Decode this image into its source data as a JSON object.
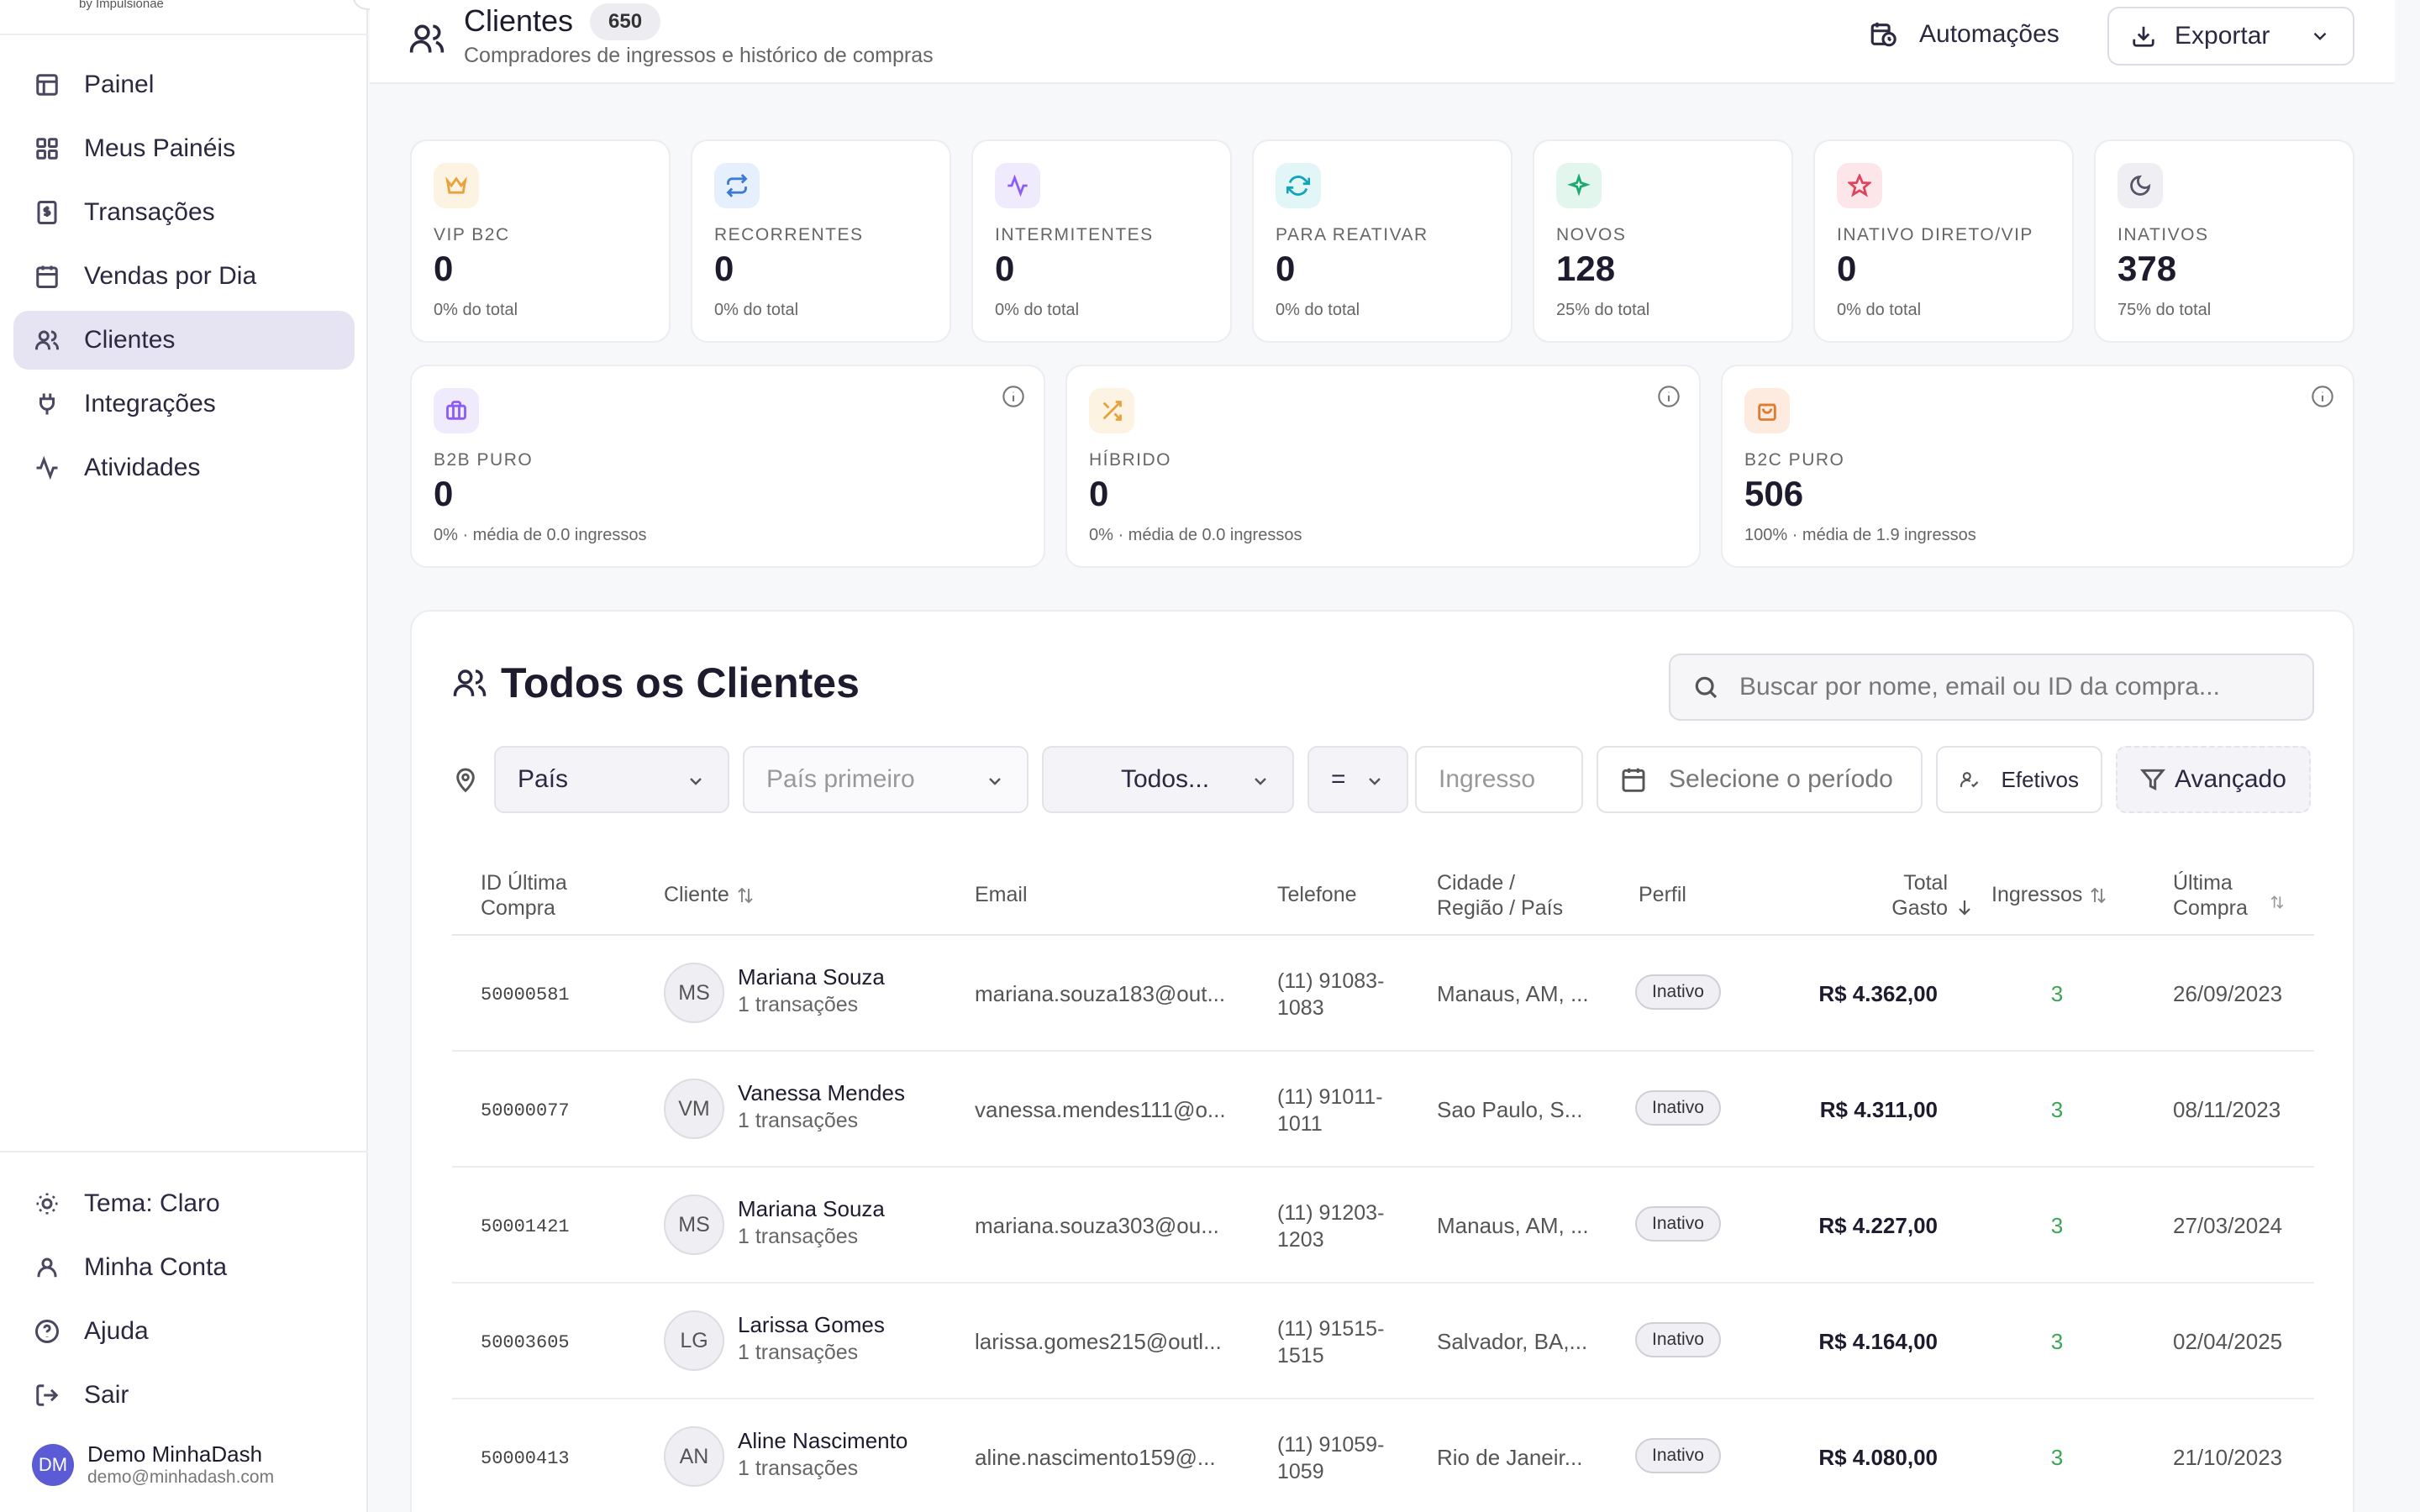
{
  "brand": {
    "tagline": "by Impulsionaê"
  },
  "sidebar": {
    "items": [
      {
        "label": "Painel",
        "icon": "layout-icon"
      },
      {
        "label": "Meus Painéis",
        "icon": "grid-icon"
      },
      {
        "label": "Transações",
        "icon": "receipt-icon"
      },
      {
        "label": "Vendas por Dia",
        "icon": "calendar-icon"
      },
      {
        "label": "Clientes",
        "icon": "users-icon",
        "active": true
      },
      {
        "label": "Integrações",
        "icon": "plug-icon"
      },
      {
        "label": "Atividades",
        "icon": "activity-icon"
      }
    ],
    "bottom": [
      {
        "label": "Tema: Claro",
        "icon": "sun-icon"
      },
      {
        "label": "Minha Conta",
        "icon": "user-icon"
      },
      {
        "label": "Ajuda",
        "icon": "help-icon"
      },
      {
        "label": "Sair",
        "icon": "logout-icon"
      }
    ],
    "user": {
      "initials": "DM",
      "name": "Demo MinhaDash",
      "email": "demo@minhadash.com"
    }
  },
  "header": {
    "title": "Clientes",
    "count": "650",
    "subtitle": "Compradores de ingressos e histórico de compras",
    "automations_label": "Automações",
    "export_label": "Exportar"
  },
  "stats": [
    {
      "label": "VIP B2C",
      "value": "0",
      "sub": "0% do total",
      "icon": "crown-icon",
      "color": "#e8a23a",
      "bg": "#fdf3e2"
    },
    {
      "label": "RECORRENTES",
      "value": "0",
      "sub": "0% do total",
      "icon": "repeat-icon",
      "color": "#3a7bd5",
      "bg": "#e6effc"
    },
    {
      "label": "INTERMITENTES",
      "value": "0",
      "sub": "0% do total",
      "icon": "pulse-icon",
      "color": "#8b5cf6",
      "bg": "#f0eafd"
    },
    {
      "label": "PARA REATIVAR",
      "value": "0",
      "sub": "0% do total",
      "icon": "refresh-icon",
      "color": "#12a4b8",
      "bg": "#e2f6f8"
    },
    {
      "label": "NOVOS",
      "value": "128",
      "sub": "25% do total",
      "icon": "sparkle-icon",
      "color": "#1fa971",
      "bg": "#e2f6ed"
    },
    {
      "label": "INATIVO DIRETO/VIP",
      "value": "0",
      "sub": "0% do total",
      "icon": "star-icon",
      "color": "#e0435c",
      "bg": "#fde6ea"
    },
    {
      "label": "INATIVOS",
      "value": "378",
      "sub": "75% do total",
      "icon": "moon-icon",
      "color": "#555566",
      "bg": "#efeff3"
    }
  ],
  "segments": [
    {
      "label": "B2B PURO",
      "value": "0",
      "sub": "0% · média de 0.0 ingressos",
      "icon": "briefcase-icon",
      "color": "#8b5cf6",
      "bg": "#f0eafd"
    },
    {
      "label": "HÍBRIDO",
      "value": "0",
      "sub": "0% · média de 0.0 ingressos",
      "icon": "shuffle-icon",
      "color": "#e8a23a",
      "bg": "#fdf3e2"
    },
    {
      "label": "B2C PURO",
      "value": "506",
      "sub": "100% · média de 1.9 ingressos",
      "icon": "shopping-bag-icon",
      "color": "#e07a2e",
      "bg": "#fdebdf"
    }
  ],
  "clients": {
    "title": "Todos os Clientes",
    "search_placeholder": "Buscar por nome, email ou ID da compra...",
    "filters": {
      "country": "País",
      "country_first": "País primeiro",
      "all": "Todos...",
      "operator": "=",
      "ticket_placeholder": "Ingresso",
      "period": "Selecione o período",
      "effective": "Efetivos",
      "advanced": "Avançado"
    },
    "columns": {
      "id": "ID Última Compra",
      "client": "Cliente",
      "email": "Email",
      "phone": "Telefone",
      "city": "Cidade / Região / País",
      "profile": "Perfil",
      "total": "Total Gasto",
      "tickets": "Ingressos",
      "last": "Última Compra"
    },
    "rows": [
      {
        "id": "50000581",
        "initials": "MS",
        "name": "Mariana Souza",
        "tx": "1 transações",
        "email": "mariana.souza183@out...",
        "phone": "(11) 91083-1083",
        "city": "Manaus, AM, ...",
        "profile": "Inativo",
        "total": "R$ 4.362,00",
        "tickets": "3",
        "last": "26/09/2023"
      },
      {
        "id": "50000077",
        "initials": "VM",
        "name": "Vanessa Mendes",
        "tx": "1 transações",
        "email": "vanessa.mendes111@o...",
        "phone": "(11) 91011-1011",
        "city": "Sao Paulo, S...",
        "profile": "Inativo",
        "total": "R$ 4.311,00",
        "tickets": "3",
        "last": "08/11/2023"
      },
      {
        "id": "50001421",
        "initials": "MS",
        "name": "Mariana Souza",
        "tx": "1 transações",
        "email": "mariana.souza303@ou...",
        "phone": "(11) 91203-1203",
        "city": "Manaus, AM, ...",
        "profile": "Inativo",
        "total": "R$ 4.227,00",
        "tickets": "3",
        "last": "27/03/2024"
      },
      {
        "id": "50003605",
        "initials": "LG",
        "name": "Larissa Gomes",
        "tx": "1 transações",
        "email": "larissa.gomes215@outl...",
        "phone": "(11) 91515-1515",
        "city": "Salvador, BA,...",
        "profile": "Inativo",
        "total": "R$ 4.164,00",
        "tickets": "3",
        "last": "02/04/2025"
      },
      {
        "id": "50000413",
        "initials": "AN",
        "name": "Aline Nascimento",
        "tx": "1 transações",
        "email": "aline.nascimento159@...",
        "phone": "(11) 91059-1059",
        "city": "Rio de Janeir...",
        "profile": "Inativo",
        "total": "R$ 4.080,00",
        "tickets": "3",
        "last": "21/10/2023"
      }
    ]
  }
}
